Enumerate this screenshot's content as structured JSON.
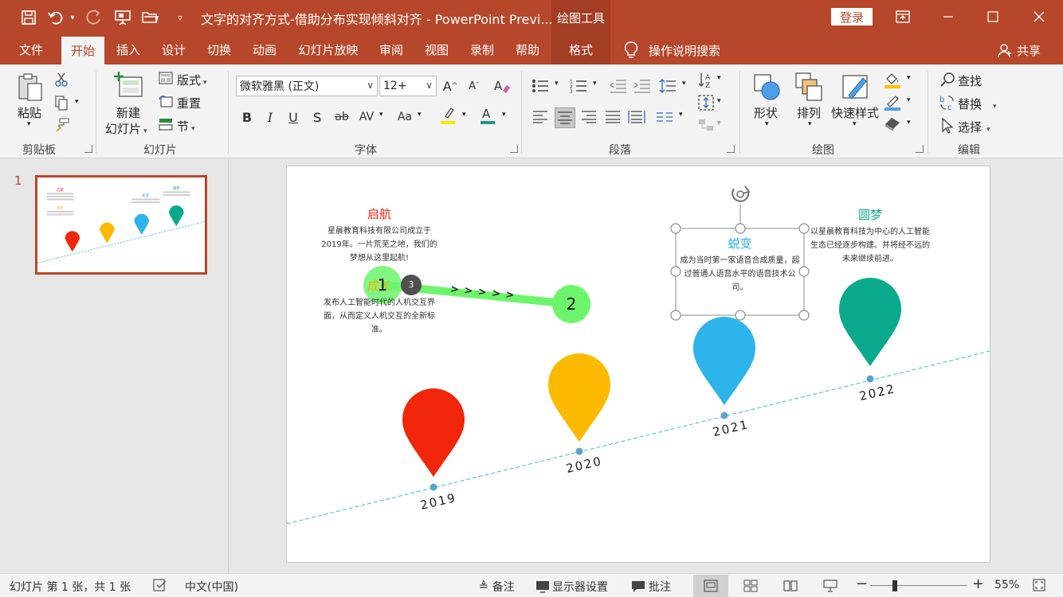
{
  "titlebar": {
    "doc_title": "文字的对齐方式-借助分布实现倾斜对齐  -  PowerPoint Previ...",
    "context_tools": "绘图工具",
    "login": "登录"
  },
  "tabs": [
    "文件",
    "开始",
    "插入",
    "设计",
    "切换",
    "动画",
    "幻灯片放映",
    "审阅",
    "视图",
    "录制",
    "帮助",
    "格式"
  ],
  "help_search": "操作说明搜索",
  "share": "共享",
  "ribbon": {
    "clipboard": {
      "paste": "粘贴",
      "label": "剪贴板"
    },
    "slides": {
      "new_slide_1": "新建",
      "new_slide_2": "幻灯片",
      "layout": "版式",
      "reset": "重置",
      "section": "节",
      "label": "幻灯片"
    },
    "font": {
      "font_name": "微软雅黑 (正文)",
      "font_size": "12+",
      "label": "字体"
    },
    "paragraph": {
      "label": "段落"
    },
    "drawing": {
      "shapes": "形状",
      "arrange": "排列",
      "quick_styles": "快速样式",
      "label": "绘图"
    },
    "editing": {
      "find": "查找",
      "replace": "替换",
      "select": "选择",
      "label": "编辑"
    }
  },
  "thumbnail": {
    "slide_number": "1"
  },
  "slide": {
    "milestones": [
      {
        "title": "启航",
        "title_color": "#ee1c0e",
        "body": "星晨教育科技有限公司成立于2019年。一片荒芜之地，我们的梦想从这里起航!"
      },
      {
        "title": "成长",
        "title_color": "#f5b400",
        "body": "发布人工智能时代的人机交互界面，从而定义人机交互的全新标准。"
      },
      {
        "title": "蜕变",
        "title_color": "#2bb2e8",
        "body": "成为当时第一家语音合成质量，超过普通人语音水平的语音技术公司。"
      },
      {
        "title": "圆梦",
        "title_color": "#10a98b",
        "body": "以星晨教育科技为中心的人工智能生态已经逐步构建。并将经不远的未来继续前进。"
      }
    ],
    "years": [
      "2019",
      "2020",
      "2021",
      "2022"
    ],
    "pin_colors": [
      "#f0260a",
      "#fbba00",
      "#2db4ea",
      "#0ba98b"
    ],
    "motion_path": {
      "start_label": "1",
      "end_label": "2",
      "badge": "3",
      "arrows": "> > > > >"
    }
  },
  "statusbar": {
    "slide_info": "幻灯片 第 1 张，共 1 张",
    "language": "中文(中国)",
    "notes": "备注",
    "display_settings": "显示器设置",
    "comments": "批注",
    "zoom": "55%"
  }
}
